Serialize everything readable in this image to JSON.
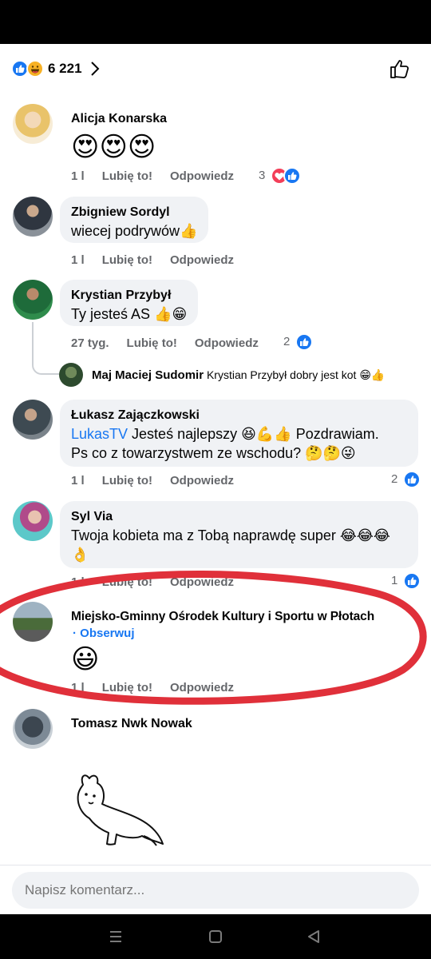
{
  "reactions_header": {
    "count": "6 221",
    "icons": [
      "like-icon",
      "haha-icon"
    ]
  },
  "comments": [
    {
      "author": "Alicja Konarska",
      "text": "😍😍😍",
      "time": "1 l",
      "like_label": "Lubię to!",
      "reply_label": "Odpowiedz",
      "reaction_count": "3",
      "reaction_icons": [
        "heart-icon",
        "like-icon"
      ]
    },
    {
      "author": "Zbigniew Sordyl",
      "text": "wiecej podrywów👍",
      "time": "1 l",
      "like_label": "Lubię to!",
      "reply_label": "Odpowiedz"
    },
    {
      "author": "Krystian Przybył",
      "text": "Ty jesteś AS 👍😁",
      "time": "27 tyg.",
      "like_label": "Lubię to!",
      "reply_label": "Odpowiedz",
      "reaction_count": "2",
      "reaction_icons": [
        "like-icon"
      ],
      "reply": {
        "author": "Maj Maciej Sudomir",
        "text": "Krystian Przybył dobry jest kot 😁👍"
      }
    },
    {
      "author": "Łukasz Zajączkowski",
      "link": "LukasTV",
      "text_line1": " Jesteś najlepszy 😆💪👍 Pozdrawiam.",
      "text_line2": "Ps co z towarzystwem ze wschodu? 🤔🤔😜",
      "time": "1 l",
      "like_label": "Lubię to!",
      "reply_label": "Odpowiedz",
      "reaction_count": "2",
      "reaction_icons": [
        "like-icon"
      ]
    },
    {
      "author": "Syl Via",
      "text_line1": "Twoja kobieta ma z Tobą naprawdę super 😂😂😂",
      "text_line2": "👌",
      "time": "1 l",
      "like_label": "Lubię to!",
      "reply_label": "Odpowiedz",
      "reaction_count": "1",
      "reaction_icons": [
        "like-icon"
      ]
    },
    {
      "author": "Miejsko-Gminny Ośrodek Kultury i Sportu w Płotach",
      "follow": "· Obserwuj",
      "text": "😃",
      "time": "1 l",
      "like_label": "Lubię to!",
      "reply_label": "Odpowiedz"
    },
    {
      "author": "Tomasz Nwk Nowak",
      "sticker": "cat-stretching-sticker"
    }
  ],
  "composer": {
    "placeholder": "Napisz komentarz..."
  },
  "colors": {
    "link": "#1877f2",
    "bubble": "#f0f2f5",
    "meta": "#65676b",
    "annotation": "#e0303a"
  }
}
